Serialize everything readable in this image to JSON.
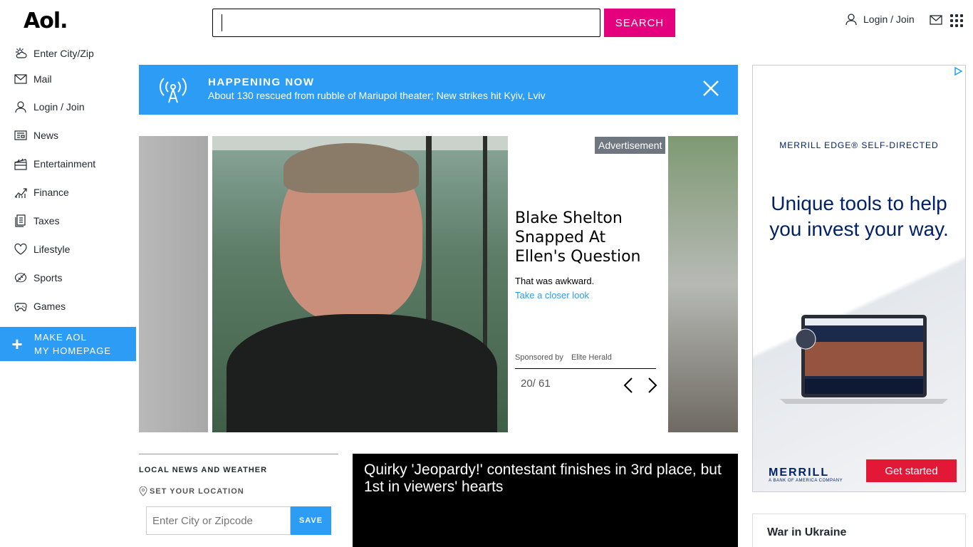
{
  "header": {
    "logo": "Aol.",
    "search_value": "",
    "search_label": "SEARCH",
    "login_label": "Login / Join"
  },
  "nav": {
    "items": [
      {
        "label": "Enter City/Zip",
        "icon": "weather-icon"
      },
      {
        "label": "Mail",
        "icon": "mail-icon"
      },
      {
        "label": "Login / Join",
        "icon": "user-icon"
      },
      {
        "label": "News",
        "icon": "news-icon"
      },
      {
        "label": "Entertainment",
        "icon": "entertainment-icon"
      },
      {
        "label": "Finance",
        "icon": "finance-icon"
      },
      {
        "label": "Taxes",
        "icon": "taxes-icon"
      },
      {
        "label": "Lifestyle",
        "icon": "heart-icon"
      },
      {
        "label": "Sports",
        "icon": "sports-icon"
      },
      {
        "label": "Games",
        "icon": "games-icon"
      }
    ],
    "make_home_line1": "MAKE AOL",
    "make_home_line2": "MY HOMEPAGE"
  },
  "banner": {
    "kicker": "HAPPENING NOW",
    "headline": "About 130 rescued from rubble of Mariupol theater; New strikes hit Kyiv, Lviv"
  },
  "slideshow": {
    "ad_tag": "Advertisement",
    "title": "Blake Shelton Snapped At Ellen's Question",
    "subtitle": "That was awkward.",
    "link": "Take a closer look",
    "sponsored_by": "Sponsored by",
    "sponsor": "Elite Herald",
    "counter": "20/ 61"
  },
  "local": {
    "title": "LOCAL NEWS AND WEATHER",
    "set_location": "SET YOUR LOCATION",
    "input_placeholder": "Enter City or Zipcode",
    "save_label": "SAVE"
  },
  "video": {
    "title": "Quirky 'Jeopardy!' contestant finishes in 3rd place, but 1st in viewers' hearts"
  },
  "right_ad": {
    "brand": "MERRILL EDGE® SELF-DIRECTED",
    "copy": "Unique tools to help you invest your way.",
    "logo": "MERRILL",
    "logo_sub": "A BANK OF AMERICA COMPANY",
    "cta": "Get started"
  },
  "sidebar_module": {
    "title": "War in Ukraine"
  },
  "colors": {
    "accent_blue": "#2d9cf4",
    "search_pink": "#e5007e",
    "merrill_navy": "#012169",
    "merrill_red": "#e31837"
  }
}
